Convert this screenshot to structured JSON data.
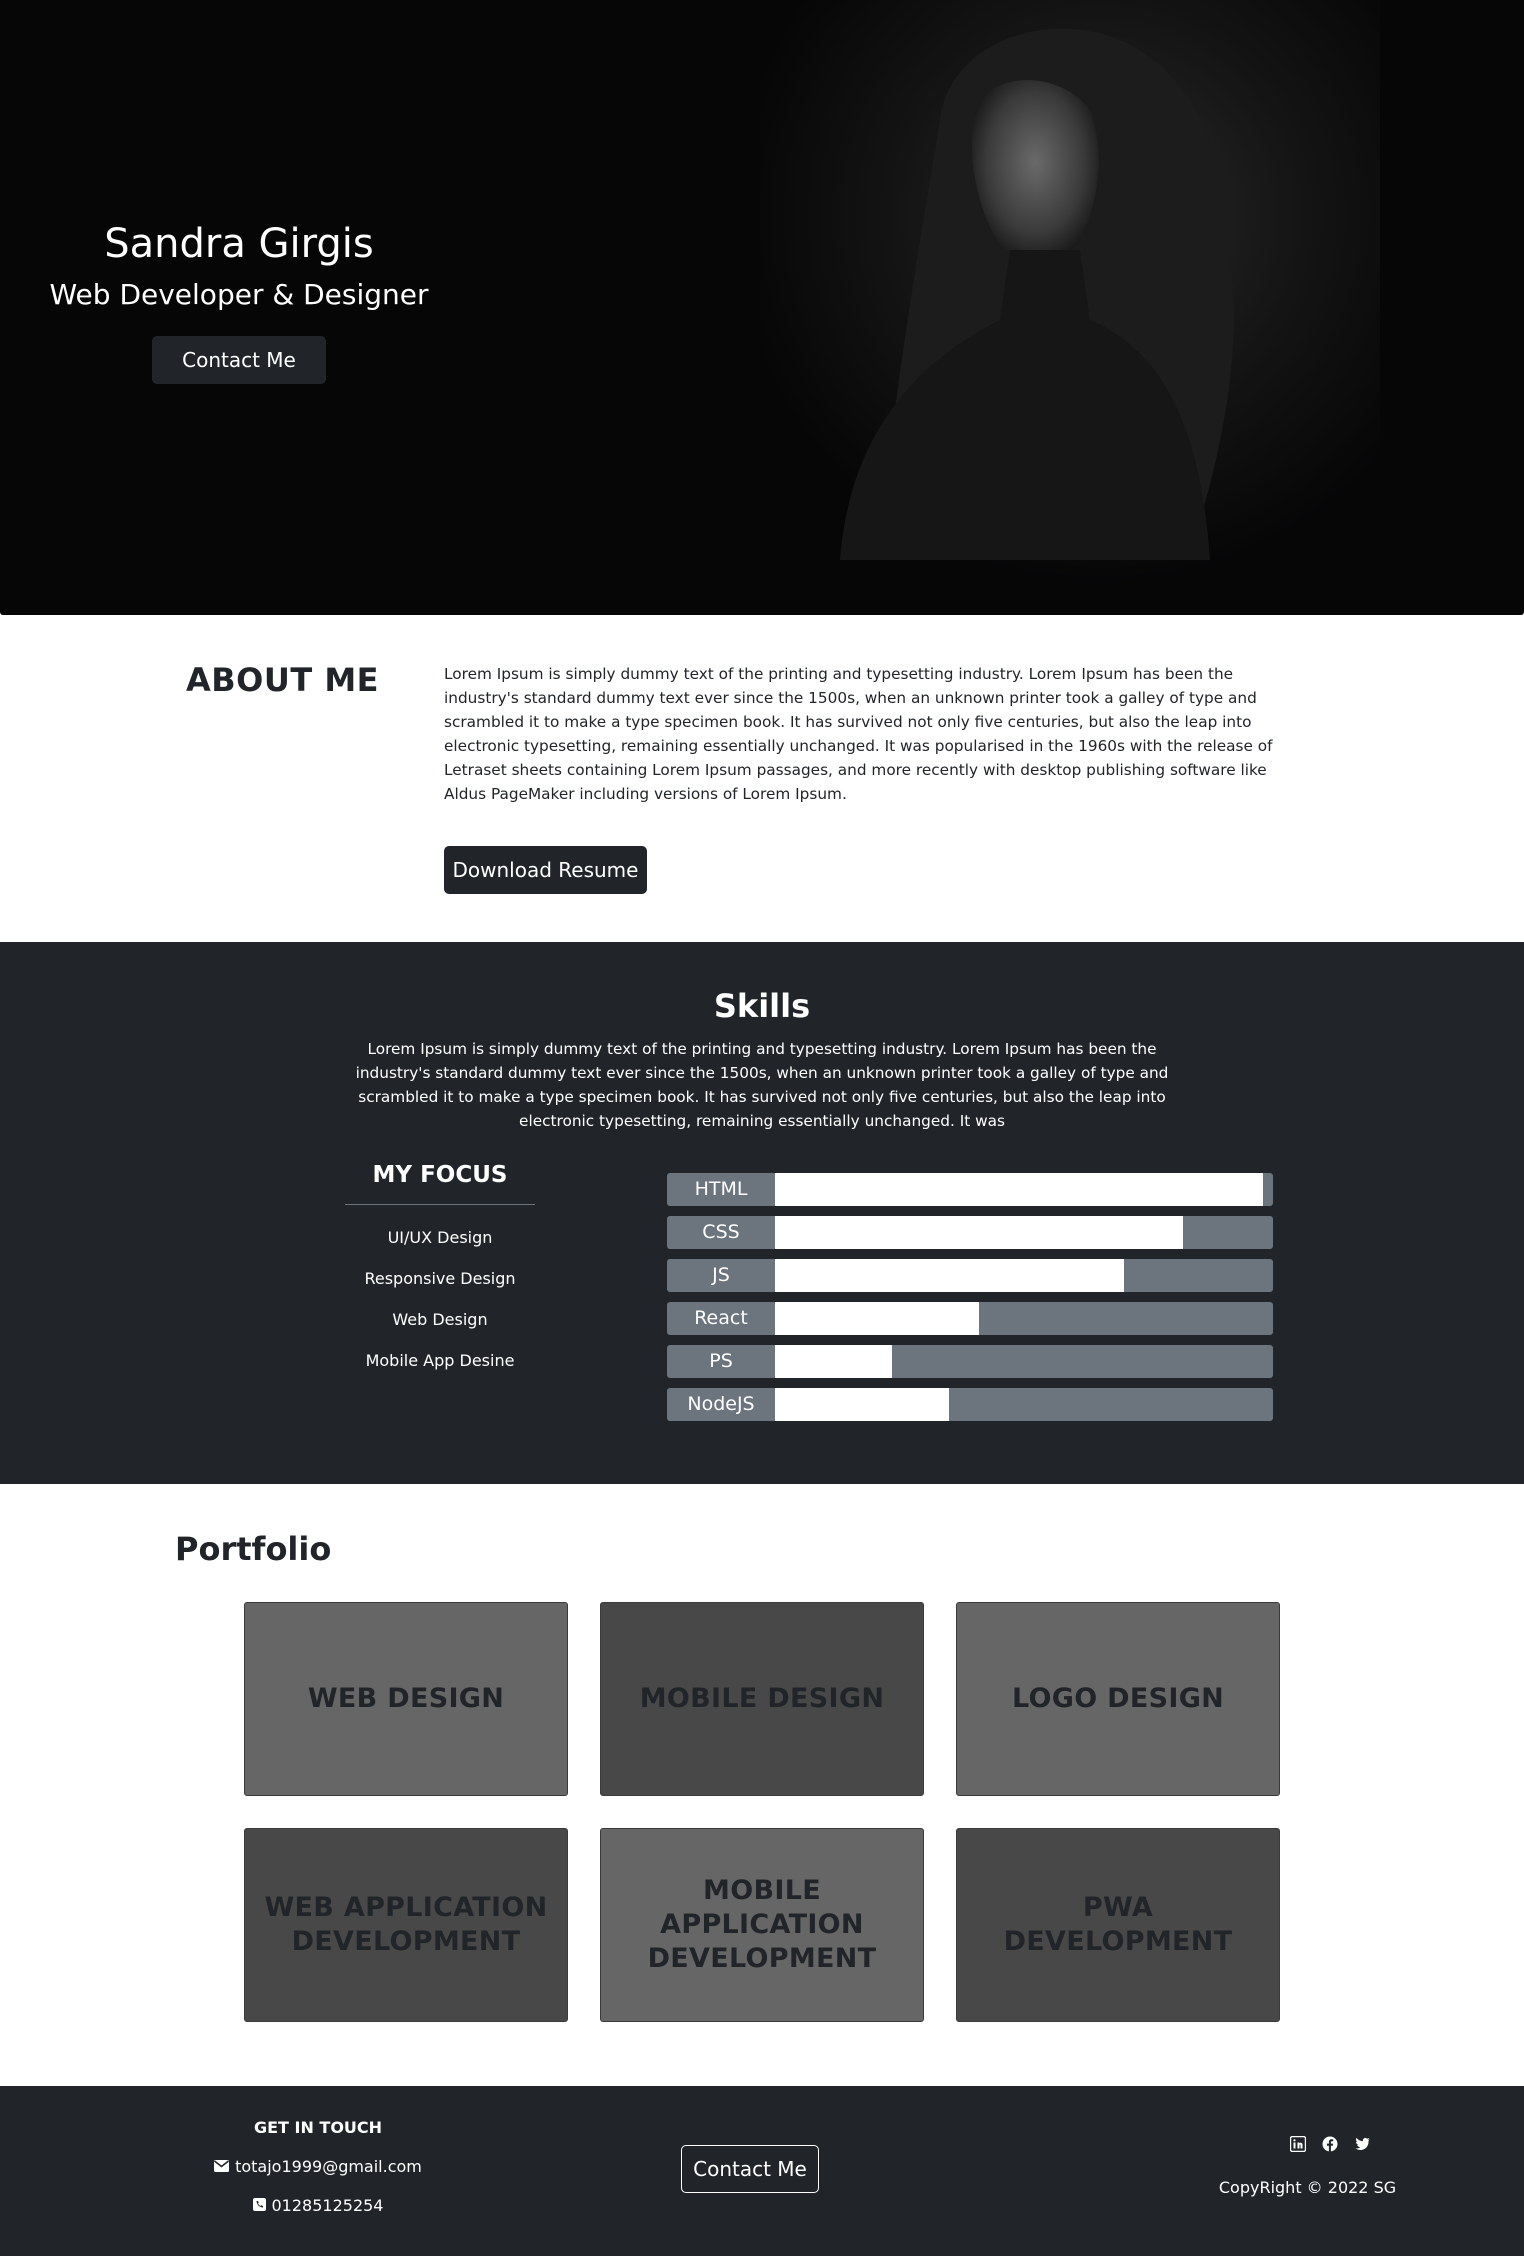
{
  "hero": {
    "name": "Sandra Girgis",
    "role": "Web Developer & Designer",
    "contact_button": "Contact Me"
  },
  "about": {
    "title": "ABOUT ME",
    "text": "Lorem Ipsum is simply dummy text of the printing and typesetting industry. Lorem Ipsum has been the industry's standard dummy text ever since the 1500s, when an unknown printer took a galley of type and scrambled it to make a type specimen book. It has survived not only five centuries, but also the leap into electronic typesetting, remaining essentially unchanged. It was popularised in the 1960s with the release of Letraset sheets containing Lorem Ipsum passages, and more recently with desktop publishing software like Aldus PageMaker including versions of Lorem Ipsum.",
    "download_button": "Download Resume"
  },
  "skills": {
    "title": "Skills",
    "description": "Lorem Ipsum is simply dummy text of the printing and typesetting industry. Lorem Ipsum has been the industry's standard dummy text ever since the 1500s, when an unknown printer took a galley of type and scrambled it to make a type specimen book. It has survived not only five centuries, but also the leap into electronic typesetting, remaining essentially unchanged. It was",
    "focus_title": "MY FOCUS",
    "focus_items": [
      "UI/UX Design",
      "Responsive Design",
      "Web Design",
      "Mobile App Desine"
    ],
    "bars": [
      {
        "label": "HTML",
        "level": 0.98
      },
      {
        "label": "CSS",
        "level": 0.82
      },
      {
        "label": "JS",
        "level": 0.7
      },
      {
        "label": "React",
        "level": 0.41
      },
      {
        "label": "PS",
        "level": 0.235
      },
      {
        "label": "NodeJS",
        "level": 0.35
      }
    ]
  },
  "portfolio": {
    "title": "Portfolio",
    "cards": [
      "WEB DESIGN",
      "MOBILE DESIGN",
      "LOGO DESIGN",
      "WEB APPLICATION DEVELOPMENT",
      "MOBILE APPLICATION DEVELOPMENT",
      "PWA DEVELOPMENT"
    ]
  },
  "footer": {
    "get_in_touch": "GET IN TOUCH",
    "email": "totajo1999@gmail.com",
    "phone": "01285125254",
    "contact_button": "Contact Me",
    "social_icons": [
      "linkedin-icon",
      "facebook-icon",
      "twitter-icon"
    ],
    "copyright": "CopyRight © 2022 SG"
  },
  "colors": {
    "dark": "#212529",
    "hero_bg": "#060607",
    "bar_track": "#6c757d",
    "card_light": "#666666",
    "card_dark": "#484848"
  }
}
